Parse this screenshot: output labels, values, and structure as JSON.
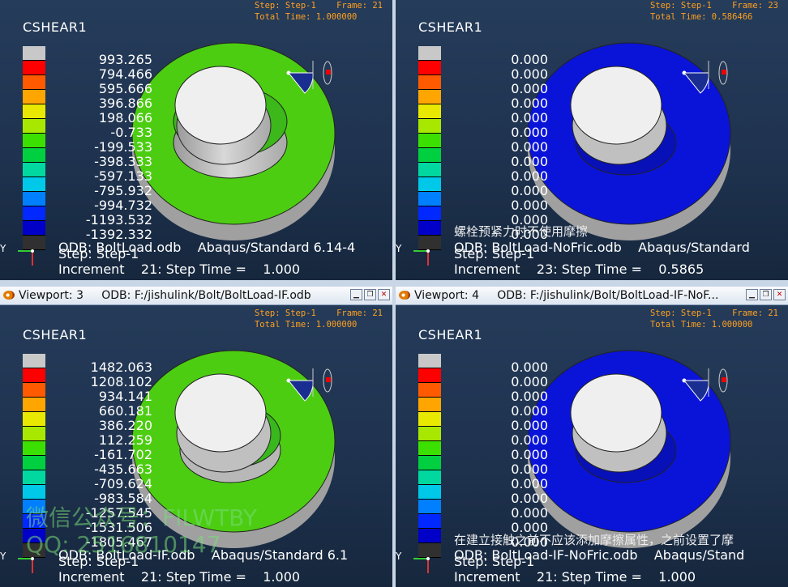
{
  "colors": {
    "legend": [
      "#c8c8c8",
      "#ff0000",
      "#ff5a00",
      "#ffa500",
      "#e8e800",
      "#a8e800",
      "#3ce000",
      "#00d040",
      "#00d8a0",
      "#00c8e8",
      "#0080ff",
      "#0028ff",
      "#0000c8",
      "#303030"
    ],
    "green_part": "#4ccd12",
    "blue_part": "#0a14d8"
  },
  "viewports": [
    {
      "id": "vp1",
      "title": "",
      "step_info": "Step: Step-1    Frame: 21\nTotal Time: 1.000000",
      "field": "CSHEAR1",
      "legend_values": [
        "993.265",
        "794.466",
        "595.666",
        "396.866",
        "198.066",
        "-0.733",
        "-199.533",
        "-398.333",
        "-597.133",
        "-795.932",
        "-994.732",
        "-1193.532",
        "-1392.332"
      ],
      "odb": "ODB: BoltLoad.odb    Abaqus/Standard 6.14-4",
      "step": "Step: Step-1",
      "increment": "Increment    21: Step Time =    1.000",
      "overlay": ""
    },
    {
      "id": "vp2",
      "title": "",
      "step_info": "Step: Step-1    Frame: 23\nTotal Time: 0.586466",
      "field": "CSHEAR1",
      "legend_values": [
        "0.000",
        "0.000",
        "0.000",
        "0.000",
        "0.000",
        "0.000",
        "0.000",
        "0.000",
        "0.000",
        "0.000",
        "0.000",
        "0.000",
        "0.000"
      ],
      "odb": "ODB: BoltLoad-NoFric.odb    Abaqus/Standard",
      "step": "Step: Step-1",
      "increment": "Increment    23: Step Time =    0.5865",
      "overlay": "螺栓预紧力时不使用摩擦"
    },
    {
      "id": "vp3",
      "title": "Viewport: 3     ODB: F:/jishulink/Bolt/BoltLoad-IF.odb",
      "step_info": "Step: Step-1    Frame: 21\nTotal Time: 1.000000",
      "field": "CSHEAR1",
      "legend_values": [
        "1482.063",
        "1208.102",
        "934.141",
        "660.181",
        "386.220",
        "112.259",
        "-161.702",
        "-435.663",
        "-709.624",
        "-983.584",
        "-1257.545",
        "-1531.506",
        "-1805.467"
      ],
      "odb": "ODB: BoltLoad-IF.odb    Abaqus/Standard 6.1",
      "step": "Step: Step-1",
      "increment": "Increment    21: Step Time =    1.000",
      "overlay": ""
    },
    {
      "id": "vp4",
      "title": "Viewport: 4     ODB: F:/jishulink/Bolt/BoltLoad-IF-NoF...",
      "step_info": "Step: Step-1    Frame: 21\nTotal Time: 1.000000",
      "field": "CSHEAR1",
      "legend_values": [
        "0.000",
        "0.000",
        "0.000",
        "0.000",
        "0.000",
        "0.000",
        "0.000",
        "0.000",
        "0.000",
        "0.000",
        "0.000",
        "0.000",
        "0.000"
      ],
      "odb": "ODB: BoltLoad-IF-NoFric.odb    Abaqus/Stand",
      "step": "Step: Step-1",
      "increment": "Increment    21: Step Time =    1.000",
      "overlay": "在建立接触之前不应该添加摩擦属性，之前设置了摩"
    }
  ],
  "watermark": {
    "line1": "微信公众号：FILWTBY",
    "line2": "QQ: 2516810147"
  },
  "icons": [
    "viewport-icon",
    "minimize-icon",
    "restore-icon",
    "close-icon",
    "triad-icon",
    "view-triad-icon"
  ]
}
